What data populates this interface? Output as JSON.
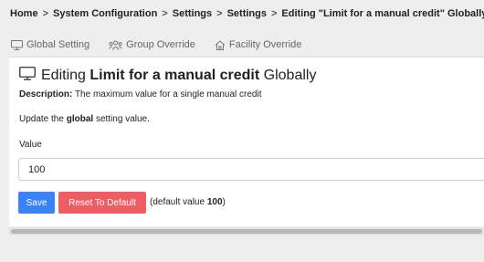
{
  "breadcrumb": {
    "items": [
      "Home",
      "System Configuration",
      "Settings",
      "Settings",
      "Editing \"Limit for a manual credit\" Globally"
    ],
    "separator": ">"
  },
  "tabs": [
    {
      "label": "Global Setting",
      "icon": "monitor-icon"
    },
    {
      "label": "Group Override",
      "icon": "users-icon"
    },
    {
      "label": "Facility Override",
      "icon": "home-icon"
    }
  ],
  "header": {
    "prefix": "Editing",
    "setting_name": "Limit for a manual credit",
    "suffix": "Globally",
    "icon": "monitor-icon"
  },
  "description": {
    "label": "Description:",
    "text": "The maximum value for a single manual credit"
  },
  "instruction": {
    "before": "Update the",
    "bold": "global",
    "after": "setting value."
  },
  "field": {
    "label": "Value",
    "value": "100"
  },
  "buttons": {
    "save": "Save",
    "reset": "Reset To Default"
  },
  "default_note": {
    "before": "(default value",
    "value": "100",
    "after": ")"
  },
  "colors": {
    "save": "#3b82f6",
    "reset": "#ef5d64",
    "background": "#eeeeee",
    "panel": "#ffffff"
  }
}
